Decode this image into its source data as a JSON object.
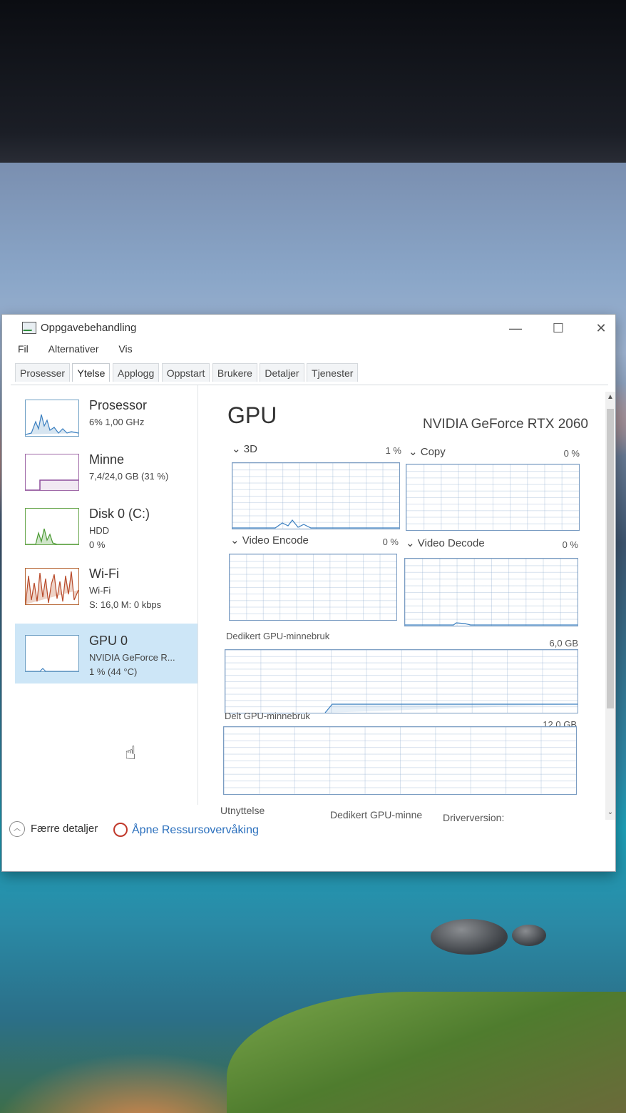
{
  "window": {
    "title": "Oppgavebehandling",
    "controls": {
      "minimize": "—",
      "maximize": "☐",
      "close": "✕"
    }
  },
  "menu": [
    "Fil",
    "Alternativer",
    "Vis"
  ],
  "tabs": [
    "Prosesser",
    "Ytelse",
    "Applogg",
    "Oppstart",
    "Brukere",
    "Detaljer",
    "Tjenester"
  ],
  "active_tab": "Ytelse",
  "sidebar": [
    {
      "title": "Prosessor",
      "line1": "6% 1,00 GHz",
      "line2": ""
    },
    {
      "title": "Minne",
      "line1": "7,4/24,0 GB (31 %)",
      "line2": ""
    },
    {
      "title": "Disk 0 (C:)",
      "line1": "HDD",
      "line2": "0 %"
    },
    {
      "title": "Wi-Fi",
      "line1": "Wi-Fi",
      "line2": "S: 16,0 M: 0 kbps"
    },
    {
      "title": "GPU 0",
      "line1": "NVIDIA GeForce R...",
      "line2": "1 % (44 °C)"
    }
  ],
  "gpu": {
    "heading": "GPU",
    "name": "NVIDIA GeForce RTX 2060",
    "engines": [
      {
        "label": "3D",
        "pct": "1 %"
      },
      {
        "label": "Copy",
        "pct": "0 %"
      },
      {
        "label": "Video Encode",
        "pct": "0 %"
      },
      {
        "label": "Video Decode",
        "pct": "0 %"
      }
    ],
    "dedicated_label": "Dedikert GPU-minnebruk",
    "dedicated_max": "6,0 GB",
    "shared_label": "Delt GPU-minnebruk",
    "shared_max": "12,0 GB",
    "bottom": [
      "Utnyttelse",
      "Dedikert GPU-minne",
      "Driverversion:"
    ]
  },
  "footer": {
    "fewer_details": "Færre detaljer",
    "resource_monitor": "Åpne Ressursovervåking"
  },
  "colors": {
    "accent": "#2a6fbd",
    "selected": "#cde6f7",
    "graph_border": "#7a9cc2"
  }
}
